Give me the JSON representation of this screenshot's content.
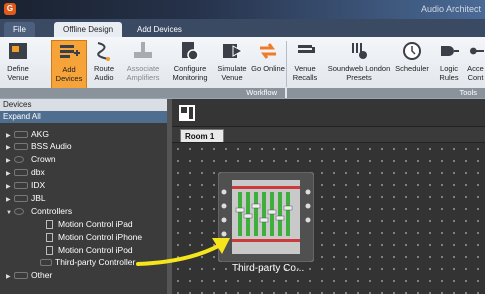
{
  "window": {
    "title": "Audio Architect",
    "app_icon": "G"
  },
  "menu": {
    "tabs": [
      "File",
      "Offline Design",
      "Add Devices"
    ]
  },
  "ribbon": {
    "workflow": [
      {
        "label": "Define Venue",
        "icon": "define-venue-icon",
        "state": "normal"
      },
      {
        "label": "Add Devices",
        "icon": "add-devices-icon",
        "state": "active"
      },
      {
        "label": "Route Audio",
        "icon": "route-audio-icon",
        "state": "normal"
      },
      {
        "label": "Associate Amplifiers",
        "icon": "associate-amplifiers-icon",
        "state": "disabled"
      },
      {
        "label": "Configure Monitoring",
        "icon": "configure-monitoring-icon",
        "state": "normal"
      },
      {
        "label": "Simulate Venue",
        "icon": "simulate-venue-icon",
        "state": "normal"
      },
      {
        "label": "Go Online",
        "icon": "go-online-icon",
        "state": "normal"
      }
    ],
    "workflow_label": "Workflow",
    "tools": [
      {
        "label": "Venue Recalls",
        "icon": "venue-recalls-icon"
      },
      {
        "label": "Soundweb London Presets",
        "icon": "presets-icon"
      },
      {
        "label": "Scheduler",
        "icon": "scheduler-icon"
      },
      {
        "label": "Logic Rules",
        "icon": "logic-rules-icon"
      },
      {
        "label": "Acce Cont",
        "icon": "access-control-icon"
      }
    ],
    "tools_label": "Tools"
  },
  "devices_panel": {
    "title": "Devices",
    "expand_all": "Expand All",
    "items": [
      {
        "label": "AKG",
        "level": 0,
        "expanded": false
      },
      {
        "label": "BSS Audio",
        "level": 0,
        "expanded": false
      },
      {
        "label": "Crown",
        "level": 0,
        "expanded": false
      },
      {
        "label": "dbx",
        "level": 0,
        "expanded": false
      },
      {
        "label": "IDX",
        "level": 0,
        "expanded": false
      },
      {
        "label": "JBL",
        "level": 0,
        "expanded": false
      },
      {
        "label": "Controllers",
        "level": 0,
        "expanded": true
      },
      {
        "label": "Motion Control iPad",
        "level": 1
      },
      {
        "label": "Motion Control iPhone",
        "level": 1
      },
      {
        "label": "Motion Control iPod",
        "level": 1
      },
      {
        "label": "Third-party Controller",
        "level": 1
      },
      {
        "label": "Other",
        "level": 0,
        "expanded": false
      }
    ]
  },
  "canvas": {
    "room_tab": "Room 1",
    "device_label": "Third-party Co...",
    "highlight_color": "#f5e51a"
  }
}
